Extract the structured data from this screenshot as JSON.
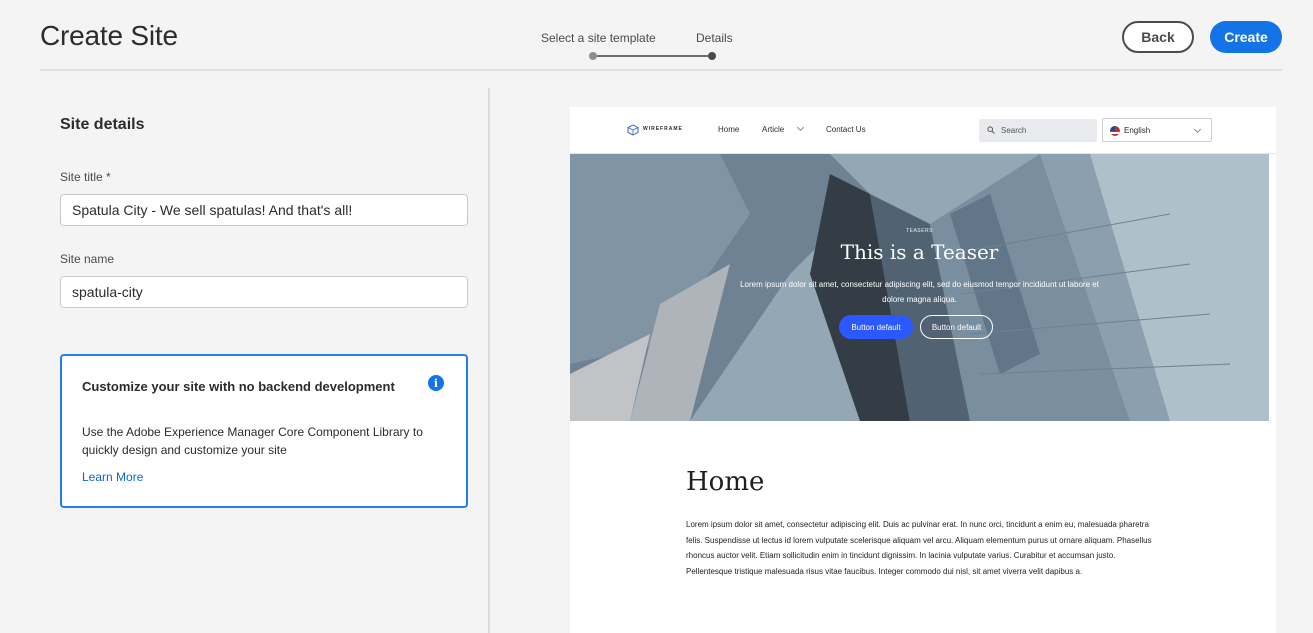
{
  "header": {
    "title": "Create Site",
    "steps": [
      {
        "label": "Select a site template"
      },
      {
        "label": "Details"
      }
    ],
    "back_label": "Back",
    "create_label": "Create"
  },
  "details": {
    "section_title": "Site details",
    "site_title_label": "Site title *",
    "site_title_value": "Spatula City - We sell spatulas! And that's all!",
    "site_name_label": "Site name",
    "site_name_value": "spatula-city"
  },
  "info_card": {
    "heading": "Customize your site with no backend development",
    "body": "Use the Adobe Experience Manager Core Component Library to quickly design and customize your site",
    "link": "Learn More",
    "icon": "i"
  },
  "preview": {
    "logo_text": "WIREFRAME",
    "nav": [
      "Home",
      "Article",
      "Contact Us"
    ],
    "search_placeholder": "Search",
    "language": "English",
    "teaser": {
      "kicker": "TEASERS",
      "title": "This is a Teaser",
      "body": "Lorem ipsum dolor sit amet, consectetur adipiscing elit, sed do eiusmod tempor incididunt ut labore et dolore magna aliqua.",
      "button1": "Button default",
      "button2": "Button default"
    },
    "page_heading": "Home",
    "paragraph": "Lorem ipsum dolor sit amet, consectetur adipiscing elit. Duis ac pulvinar erat. In nunc orci, tincidunt a enim eu, malesuada pharetra felis. Suspendisse ut lectus id lorem vulputate scelerisque aliquam vel arcu. Aliquam elementum purus ut ornare aliquam. Phasellus rhoncus auctor velit. Etiam sollicitudin enim in tincidunt dignissim. In lacinia vulputate varius. Curabitur et accumsan justo. Pellentesque tristique malesuada risus vitae faucibus. Integer commodo dui nisl, sit amet viverra velit dapibus a."
  },
  "colors": {
    "accent": "#1473e6",
    "info_border": "#2680eb",
    "teaser_primary_button": "#2b59ff"
  }
}
